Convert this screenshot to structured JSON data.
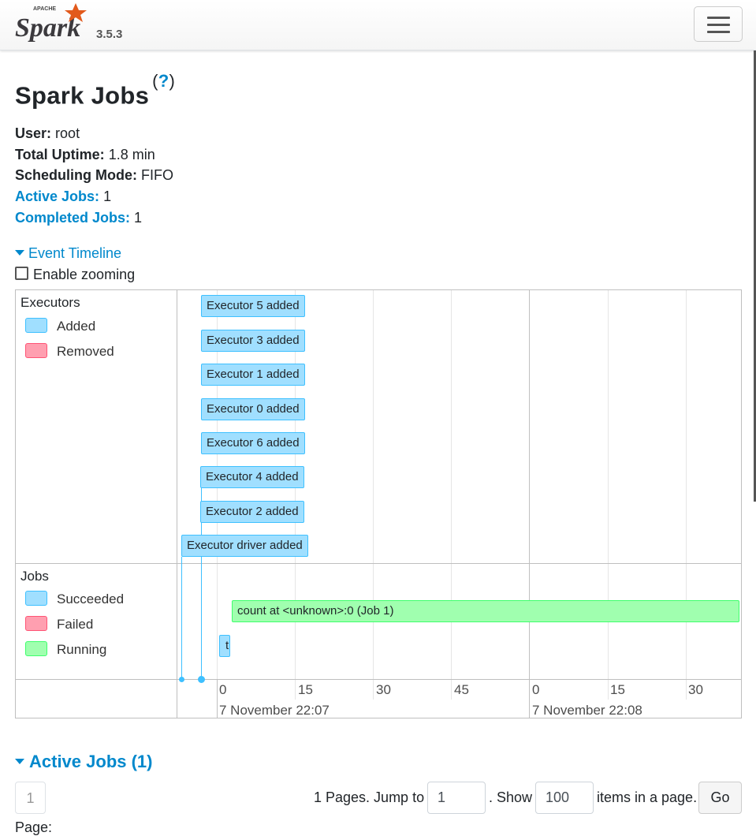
{
  "navbar": {
    "brand": "Spark",
    "brand_top": "APACHE",
    "version": "3.5.3"
  },
  "page": {
    "title": "Spark Jobs",
    "help_open": "(",
    "help_link": "?",
    "help_close": ")"
  },
  "summary": {
    "user_label": "User:",
    "user_value": "root",
    "uptime_label": "Total Uptime:",
    "uptime_value": "1.8 min",
    "mode_label": "Scheduling Mode:",
    "mode_value": "FIFO",
    "active_label": "Active Jobs:",
    "active_value": "1",
    "completed_label": "Completed Jobs:",
    "completed_value": "1"
  },
  "event_timeline": {
    "toggle_label": "Event Timeline",
    "zoom_label": "Enable zooming",
    "executors_group": {
      "title": "Executors",
      "legend": [
        {
          "label": "Added"
        },
        {
          "label": "Removed"
        }
      ],
      "items": [
        "Executor 5 added",
        "Executor 3 added",
        "Executor 1 added",
        "Executor 0 added",
        "Executor 6 added",
        "Executor 4 added",
        "Executor 2 added",
        "Executor driver added"
      ]
    },
    "jobs_group": {
      "title": "Jobs",
      "legend": [
        {
          "label": "Succeeded"
        },
        {
          "label": "Failed"
        },
        {
          "label": "Running"
        }
      ],
      "running_job": "count at <unknown>:0 (Job 1)",
      "succeeded_job": "t"
    },
    "axis": {
      "minor_ticks": [
        "0",
        "15",
        "30",
        "45",
        "0",
        "15",
        "30"
      ],
      "major_ticks": [
        "7 November 22:07",
        "7 November 22:08"
      ]
    }
  },
  "active_jobs": {
    "header": "Active Jobs (1)",
    "page_button": "1",
    "pages_text": "1 Pages. Jump to",
    "jump_value": "1",
    "show_text": ". Show",
    "show_value": "100",
    "items_text": "items in a page.",
    "go_label": "Go",
    "page_label": "Page:"
  }
}
